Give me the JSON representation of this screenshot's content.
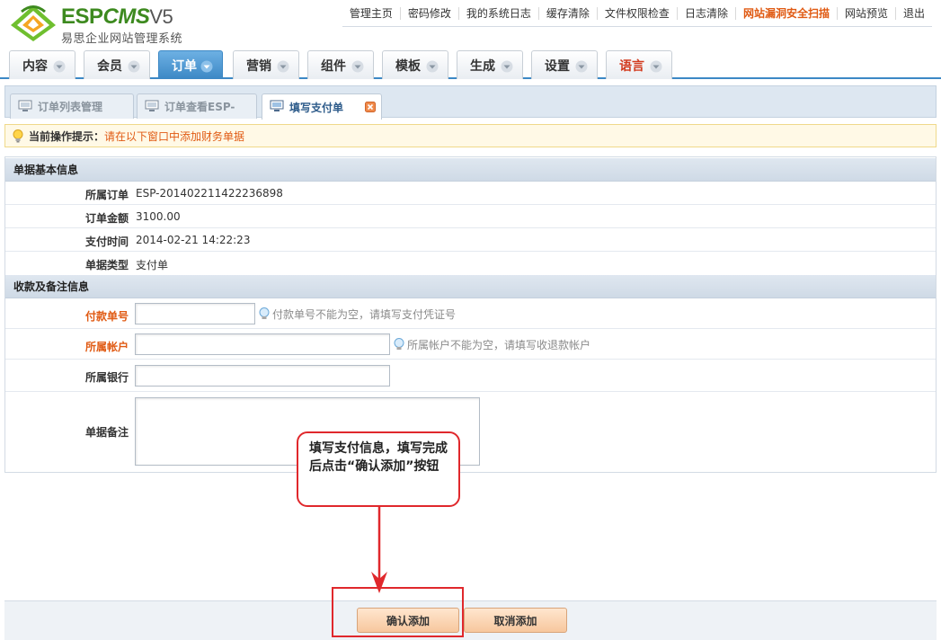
{
  "brand": {
    "title_esp": "ESP",
    "title_cms": "CMS",
    "title_version": "V5",
    "subtitle": "易思企业网站管理系统"
  },
  "toplinks": [
    {
      "label": "管理主页"
    },
    {
      "label": "密码修改"
    },
    {
      "label": "我的系统日志"
    },
    {
      "label": "缓存清除"
    },
    {
      "label": "文件权限检查"
    },
    {
      "label": "日志清除"
    },
    {
      "label": "网站漏洞安全扫描",
      "danger": true
    },
    {
      "label": "网站预览"
    },
    {
      "label": "退出"
    }
  ],
  "nav": [
    {
      "label": "内容"
    },
    {
      "label": "会员"
    },
    {
      "label": "订单",
      "active": true
    },
    {
      "label": "营销"
    },
    {
      "label": "组件"
    },
    {
      "label": "模板"
    },
    {
      "label": "生成"
    },
    {
      "label": "设置"
    },
    {
      "label": "语言"
    }
  ],
  "tabs": [
    {
      "label": "订单列表管理"
    },
    {
      "label": "订单查看ESP-"
    },
    {
      "label": "填写支付单",
      "active": true
    }
  ],
  "hint": {
    "label": "当前操作提示：",
    "message": "请在以下窗口中添加财务单据"
  },
  "sections": {
    "basic": "单据基本信息",
    "payment": "收款及备注信息"
  },
  "basic_info": [
    {
      "label": "所属订单",
      "value": "ESP-201402211422236898"
    },
    {
      "label": "订单金额",
      "value": "3100.00"
    },
    {
      "label": "支付时间",
      "value": "2014-02-21 14:22:23"
    },
    {
      "label": "单据类型",
      "value": "支付单"
    }
  ],
  "form": {
    "pay_no": {
      "label": "付款单号",
      "value": "",
      "tip": "付款单号不能为空，请填写支付凭证号"
    },
    "account": {
      "label": "所属帐户",
      "value": "",
      "tip": "所属帐户不能为空，请填写收退款帐户"
    },
    "bank": {
      "label": "所属银行",
      "value": ""
    },
    "remark": {
      "label": "单据备注",
      "value": ""
    }
  },
  "callout": {
    "text": "填写支付信息，填写完成后点击“确认添加”按钮"
  },
  "buttons": {
    "confirm": "确认添加",
    "cancel": "取消添加"
  },
  "colors": {
    "accent_blue": "#3c88c5",
    "warning_orange": "#e05a13",
    "annotation_red": "#e0282c",
    "brand_green": "#3d8a1f"
  }
}
